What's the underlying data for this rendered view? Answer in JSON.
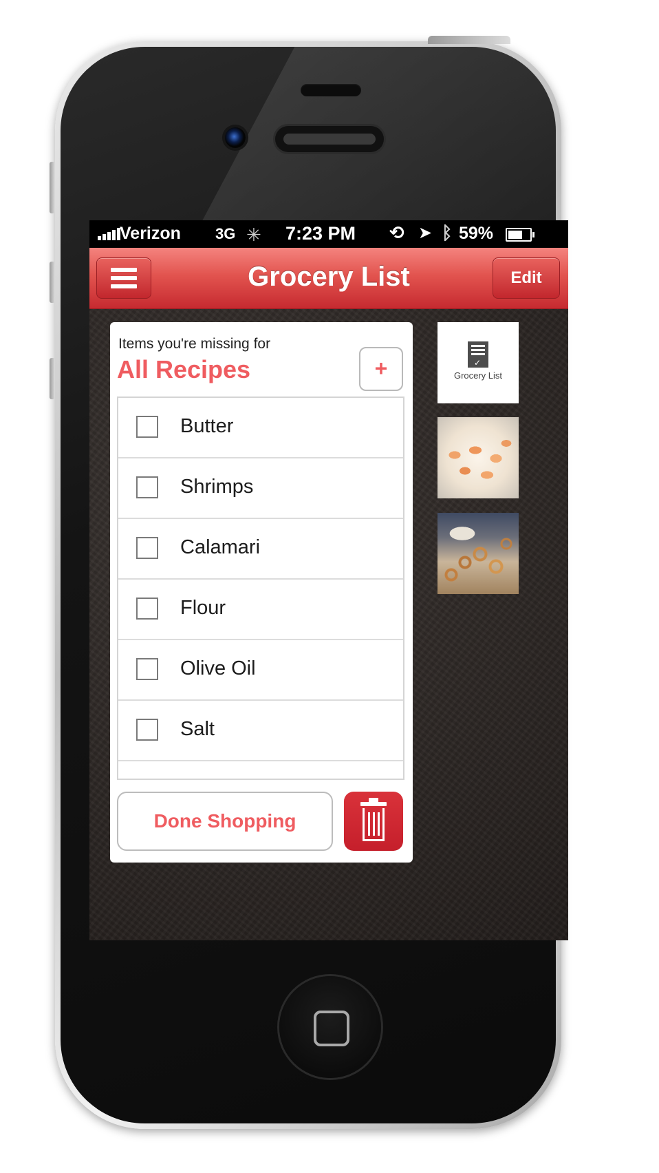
{
  "status_bar": {
    "carrier": "Verizon",
    "network": "3G",
    "time": "7:23 PM",
    "battery": "59%",
    "battery_level": 0.59,
    "icons": [
      "signal-icon",
      "activity-spinner-icon",
      "rotation-lock-icon",
      "location-arrow-icon",
      "bluetooth-icon",
      "battery-icon"
    ]
  },
  "nav": {
    "title": "Grocery List",
    "menu_icon": "hamburger-menu-icon",
    "edit_label": "Edit"
  },
  "card": {
    "subtitle": "Items you're missing for",
    "title": "All Recipes",
    "add_label": "+",
    "items": [
      {
        "label": "Butter",
        "checked": false
      },
      {
        "label": "Shrimps",
        "checked": false
      },
      {
        "label": "Calamari",
        "checked": false
      },
      {
        "label": "Flour",
        "checked": false
      },
      {
        "label": "Olive Oil",
        "checked": false
      },
      {
        "label": "Salt",
        "checked": false
      }
    ],
    "done_label": "Done Shopping",
    "trash_icon": "trash-icon"
  },
  "sidebar": {
    "grocery_label": "Grocery List",
    "grocery_icon": "document-check-icon"
  },
  "colors": {
    "accent": "#ef5c60",
    "nav_top": "#f4837e",
    "nav_bottom": "#c62a30",
    "trash": "#c51f2b"
  }
}
